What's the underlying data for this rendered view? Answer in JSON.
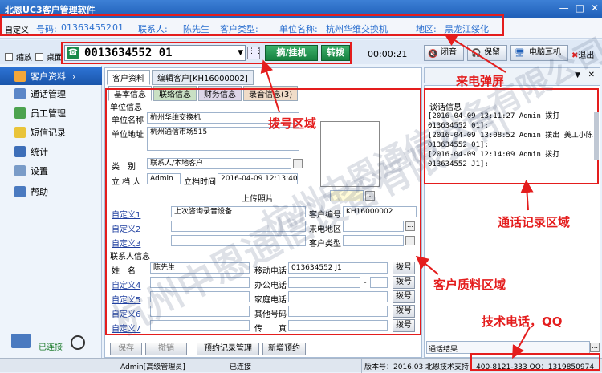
{
  "window": {
    "title": "北恩UC3客户管理软件",
    "min": "—",
    "max": "□",
    "close": "✕"
  },
  "popup": {
    "custom": "自定义",
    "phone_label": "号码:",
    "phone": "013634552",
    "ext": "01",
    "contact_label": "联系人:",
    "contact": "陈先生",
    "type_label": "客户类型:",
    "company_label": "单位名称:",
    "company": "杭州华维交换机",
    "region_label": "地区:",
    "region": "黑龙江绥化"
  },
  "toolbar": {
    "shrink": "缩放",
    "desktop": "桌面",
    "dial_number": "0013634552 01",
    "hangup": "摘/挂机",
    "transfer": "转拨",
    "timer": "00:00:21",
    "mute": "闭音",
    "hold": "保留",
    "headset": "电脑耳机",
    "exit": "退出"
  },
  "sidebar": {
    "items": [
      {
        "label": "客户资料",
        "active": true
      },
      {
        "label": "通话管理"
      },
      {
        "label": "员工管理"
      },
      {
        "label": "短信记录"
      },
      {
        "label": "统计"
      },
      {
        "label": "设置"
      },
      {
        "label": "帮助"
      }
    ],
    "connected": "已连接"
  },
  "panel": {
    "tab_main": "客户资料",
    "tab_edit": "编辑客户[KH16000002]",
    "subtabs": [
      "基本信息",
      "联络信息",
      "财务信息",
      "录音信息(3)"
    ],
    "section_unit": "单位信息",
    "company_label": "单位名称",
    "company": "杭州华维交换机",
    "address_label": "单位地址",
    "address": "杭州通信市场515",
    "category_label": "类　别",
    "category": "联系人/本地客户",
    "creator_label": "立 档 人",
    "creator": "Admin",
    "created_label": "立档时间",
    "created": "2016-04-09 12:13:40",
    "upload_photo": "上传照片",
    "custom1": "自定义1",
    "custom1_val": "上次咨询录音设备",
    "custom2": "自定义2",
    "custom3": "自定义3",
    "custno_label": "客户编号",
    "custno": "KH16000002",
    "area_label": "来电地区",
    "custtype_label": "客户类型",
    "section_contact": "联系人信息",
    "name_label": "姓　名",
    "name": "陈先生",
    "mobile_label": "移动电话",
    "mobile": "013634552 J1",
    "custom4": "自定义4",
    "custom5": "自定义5",
    "custom6": "自定义6",
    "custom7": "自定义7",
    "office_label": "办公电话",
    "home_label": "家庭电话",
    "other_label": "其他号码",
    "fax_label": "传　　真",
    "dial": "拨号",
    "dash": "-",
    "save": "保存",
    "cancel": "撤销",
    "appt_mgmt": "预约记录管理",
    "new_appt": "新增预约"
  },
  "right": {
    "header": "谈话信息",
    "log": [
      "[2016-04-09 13:11:27 Admin 拨打 013634552 01]:",
      "[2016-04-09 13:08:52 Admin 拨出 美工小陈 013634552 01]:",
      "[2016-04-09 12:14:09 Admin 拨打 013634552 J1]:"
    ],
    "result": "通话结果"
  },
  "status": {
    "user": "Admin[高级管理员]",
    "conn": "已连接",
    "version": "版本号：2016.03",
    "support": "北恩技术支持：400-8121-333 QQ：1319850974"
  },
  "annotations": {
    "popup": "来电弹屏",
    "dial": "拨号区域",
    "log": "通话记录区域",
    "profile": "客户质料区域",
    "support": "技术电话，QQ"
  },
  "watermark": [
    "杭州中恩通信设备有限公司",
    "杭州中恩通信设备有限公司"
  ]
}
